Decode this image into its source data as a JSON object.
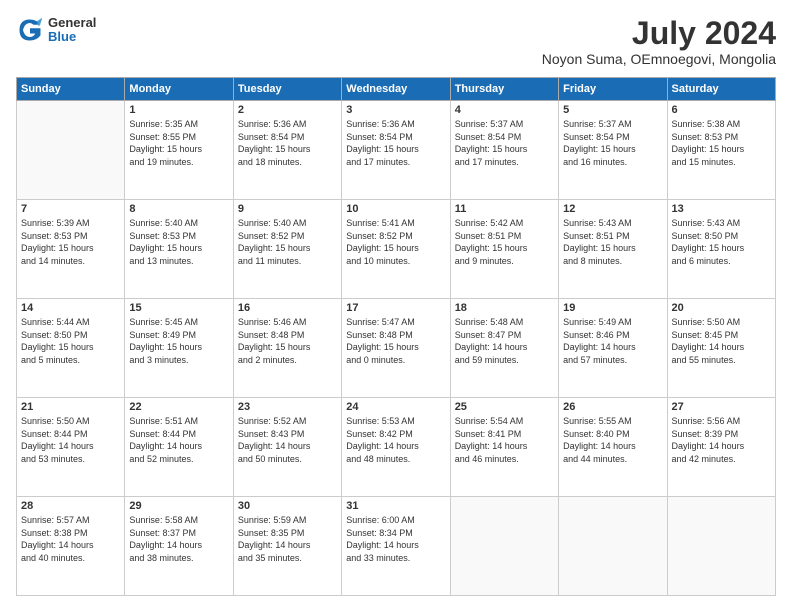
{
  "logo": {
    "line1": "General",
    "line2": "Blue"
  },
  "title": "July 2024",
  "location": "Noyon Suma, OEmnoegovi, Mongolia",
  "weekdays": [
    "Sunday",
    "Monday",
    "Tuesday",
    "Wednesday",
    "Thursday",
    "Friday",
    "Saturday"
  ],
  "weeks": [
    [
      {
        "day": "",
        "info": ""
      },
      {
        "day": "1",
        "info": "Sunrise: 5:35 AM\nSunset: 8:55 PM\nDaylight: 15 hours\nand 19 minutes."
      },
      {
        "day": "2",
        "info": "Sunrise: 5:36 AM\nSunset: 8:54 PM\nDaylight: 15 hours\nand 18 minutes."
      },
      {
        "day": "3",
        "info": "Sunrise: 5:36 AM\nSunset: 8:54 PM\nDaylight: 15 hours\nand 17 minutes."
      },
      {
        "day": "4",
        "info": "Sunrise: 5:37 AM\nSunset: 8:54 PM\nDaylight: 15 hours\nand 17 minutes."
      },
      {
        "day": "5",
        "info": "Sunrise: 5:37 AM\nSunset: 8:54 PM\nDaylight: 15 hours\nand 16 minutes."
      },
      {
        "day": "6",
        "info": "Sunrise: 5:38 AM\nSunset: 8:53 PM\nDaylight: 15 hours\nand 15 minutes."
      }
    ],
    [
      {
        "day": "7",
        "info": "Sunrise: 5:39 AM\nSunset: 8:53 PM\nDaylight: 15 hours\nand 14 minutes."
      },
      {
        "day": "8",
        "info": "Sunrise: 5:40 AM\nSunset: 8:53 PM\nDaylight: 15 hours\nand 13 minutes."
      },
      {
        "day": "9",
        "info": "Sunrise: 5:40 AM\nSunset: 8:52 PM\nDaylight: 15 hours\nand 11 minutes."
      },
      {
        "day": "10",
        "info": "Sunrise: 5:41 AM\nSunset: 8:52 PM\nDaylight: 15 hours\nand 10 minutes."
      },
      {
        "day": "11",
        "info": "Sunrise: 5:42 AM\nSunset: 8:51 PM\nDaylight: 15 hours\nand 9 minutes."
      },
      {
        "day": "12",
        "info": "Sunrise: 5:43 AM\nSunset: 8:51 PM\nDaylight: 15 hours\nand 8 minutes."
      },
      {
        "day": "13",
        "info": "Sunrise: 5:43 AM\nSunset: 8:50 PM\nDaylight: 15 hours\nand 6 minutes."
      }
    ],
    [
      {
        "day": "14",
        "info": "Sunrise: 5:44 AM\nSunset: 8:50 PM\nDaylight: 15 hours\nand 5 minutes."
      },
      {
        "day": "15",
        "info": "Sunrise: 5:45 AM\nSunset: 8:49 PM\nDaylight: 15 hours\nand 3 minutes."
      },
      {
        "day": "16",
        "info": "Sunrise: 5:46 AM\nSunset: 8:48 PM\nDaylight: 15 hours\nand 2 minutes."
      },
      {
        "day": "17",
        "info": "Sunrise: 5:47 AM\nSunset: 8:48 PM\nDaylight: 15 hours\nand 0 minutes."
      },
      {
        "day": "18",
        "info": "Sunrise: 5:48 AM\nSunset: 8:47 PM\nDaylight: 14 hours\nand 59 minutes."
      },
      {
        "day": "19",
        "info": "Sunrise: 5:49 AM\nSunset: 8:46 PM\nDaylight: 14 hours\nand 57 minutes."
      },
      {
        "day": "20",
        "info": "Sunrise: 5:50 AM\nSunset: 8:45 PM\nDaylight: 14 hours\nand 55 minutes."
      }
    ],
    [
      {
        "day": "21",
        "info": "Sunrise: 5:50 AM\nSunset: 8:44 PM\nDaylight: 14 hours\nand 53 minutes."
      },
      {
        "day": "22",
        "info": "Sunrise: 5:51 AM\nSunset: 8:44 PM\nDaylight: 14 hours\nand 52 minutes."
      },
      {
        "day": "23",
        "info": "Sunrise: 5:52 AM\nSunset: 8:43 PM\nDaylight: 14 hours\nand 50 minutes."
      },
      {
        "day": "24",
        "info": "Sunrise: 5:53 AM\nSunset: 8:42 PM\nDaylight: 14 hours\nand 48 minutes."
      },
      {
        "day": "25",
        "info": "Sunrise: 5:54 AM\nSunset: 8:41 PM\nDaylight: 14 hours\nand 46 minutes."
      },
      {
        "day": "26",
        "info": "Sunrise: 5:55 AM\nSunset: 8:40 PM\nDaylight: 14 hours\nand 44 minutes."
      },
      {
        "day": "27",
        "info": "Sunrise: 5:56 AM\nSunset: 8:39 PM\nDaylight: 14 hours\nand 42 minutes."
      }
    ],
    [
      {
        "day": "28",
        "info": "Sunrise: 5:57 AM\nSunset: 8:38 PM\nDaylight: 14 hours\nand 40 minutes."
      },
      {
        "day": "29",
        "info": "Sunrise: 5:58 AM\nSunset: 8:37 PM\nDaylight: 14 hours\nand 38 minutes."
      },
      {
        "day": "30",
        "info": "Sunrise: 5:59 AM\nSunset: 8:35 PM\nDaylight: 14 hours\nand 35 minutes."
      },
      {
        "day": "31",
        "info": "Sunrise: 6:00 AM\nSunset: 8:34 PM\nDaylight: 14 hours\nand 33 minutes."
      },
      {
        "day": "",
        "info": ""
      },
      {
        "day": "",
        "info": ""
      },
      {
        "day": "",
        "info": ""
      }
    ]
  ]
}
